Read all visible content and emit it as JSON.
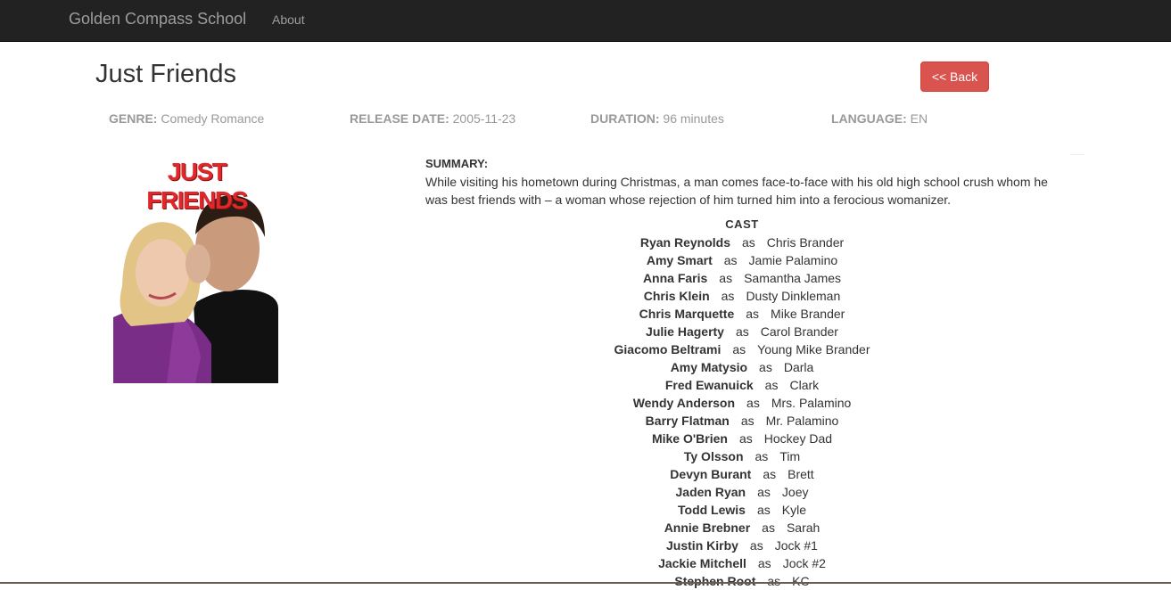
{
  "navbar": {
    "brand": "Golden Compass School",
    "links": [
      "About"
    ]
  },
  "page": {
    "title": "Just Friends",
    "back_label": "<< Back"
  },
  "meta": {
    "genre_label": "GENRE:",
    "genre": "Comedy Romance",
    "release_label": "RELEASE DATE:",
    "release": "2005-11-23",
    "duration_label": "DURATION:",
    "duration": "96 minutes",
    "language_label": "LANGUAGE:",
    "language": "EN"
  },
  "poster": {
    "title_text": "JUST FRIENDS"
  },
  "summary": {
    "label": "SUMMARY:",
    "text": "While visiting his hometown during Christmas, a man comes face-to-face with his old high school crush whom he was best friends with – a woman whose rejection of him turned him into a ferocious womanizer."
  },
  "cast": {
    "label": "CAST",
    "as_word": "as",
    "members": [
      {
        "actor": "Ryan Reynolds",
        "role": "Chris Brander"
      },
      {
        "actor": "Amy Smart",
        "role": "Jamie Palamino"
      },
      {
        "actor": "Anna Faris",
        "role": "Samantha James"
      },
      {
        "actor": "Chris Klein",
        "role": "Dusty Dinkleman"
      },
      {
        "actor": "Chris Marquette",
        "role": "Mike Brander"
      },
      {
        "actor": "Julie Hagerty",
        "role": "Carol Brander"
      },
      {
        "actor": "Giacomo Beltrami",
        "role": "Young Mike Brander"
      },
      {
        "actor": "Amy Matysio",
        "role": "Darla"
      },
      {
        "actor": "Fred Ewanuick",
        "role": "Clark"
      },
      {
        "actor": "Wendy Anderson",
        "role": "Mrs. Palamino"
      },
      {
        "actor": "Barry Flatman",
        "role": "Mr. Palamino"
      },
      {
        "actor": "Mike O'Brien",
        "role": "Hockey Dad"
      },
      {
        "actor": "Ty Olsson",
        "role": "Tim"
      },
      {
        "actor": "Devyn Burant",
        "role": "Brett"
      },
      {
        "actor": "Jaden Ryan",
        "role": "Joey"
      },
      {
        "actor": "Todd Lewis",
        "role": "Kyle"
      },
      {
        "actor": "Annie Brebner",
        "role": "Sarah"
      },
      {
        "actor": "Justin Kirby",
        "role": "Jock #1"
      },
      {
        "actor": "Jackie Mitchell",
        "role": "Jock #2"
      },
      {
        "actor": "Stephen Root",
        "role": "KC"
      }
    ]
  },
  "colors": {
    "navbar_bg": "#222222",
    "back_button": "#d9534f",
    "poster_title": "#e2272a"
  }
}
